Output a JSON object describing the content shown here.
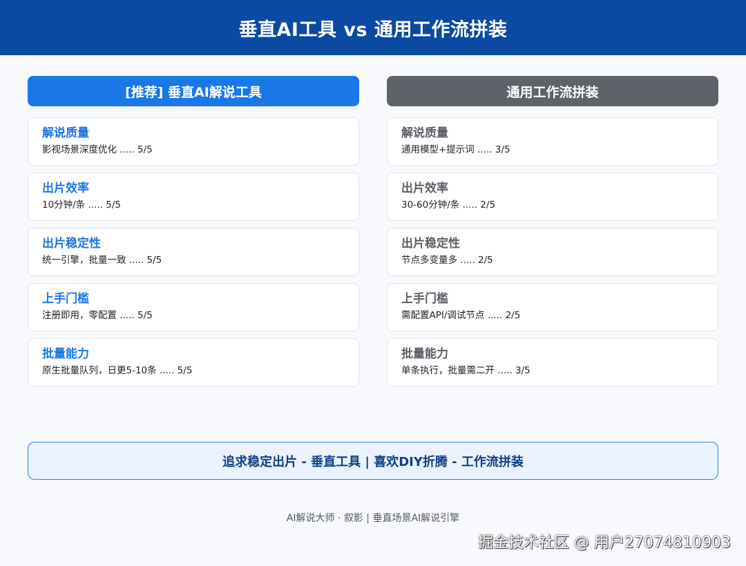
{
  "header": {
    "title": "垂直AI工具 vs 通用工作流拼装"
  },
  "left": {
    "title": "[推荐] 垂直AI解说工具",
    "items": [
      {
        "title": "解说质量",
        "detail": "影视场景深度优化 ..... 5/5"
      },
      {
        "title": "出片效率",
        "detail": "10分钟/条 ..... 5/5"
      },
      {
        "title": "出片稳定性",
        "detail": "统一引擎，批量一致 ..... 5/5"
      },
      {
        "title": "上手门槛",
        "detail": "注册即用，零配置 ..... 5/5"
      },
      {
        "title": "批量能力",
        "detail": "原生批量队列，日更5-10条 ..... 5/5"
      }
    ]
  },
  "right": {
    "title": "通用工作流拼装",
    "items": [
      {
        "title": "解说质量",
        "detail": "通用模型+提示词 ..... 3/5"
      },
      {
        "title": "出片效率",
        "detail": "30-60分钟/条 ..... 2/5"
      },
      {
        "title": "出片稳定性",
        "detail": "节点多变量多 ..... 2/5"
      },
      {
        "title": "上手门槛",
        "detail": "需配置API/调试节点 ..... 2/5"
      },
      {
        "title": "批量能力",
        "detail": "单条执行，批量需二开 ..... 3/5"
      }
    ]
  },
  "summary": {
    "text": "追求稳定出片 - 垂直工具 | 喜欢DIY折腾 - 工作流拼装"
  },
  "footer": {
    "text": "AI解说大师 · 叙影 | 垂直场景AI解说引擎"
  },
  "watermark": {
    "text": "掘金技术社区 @ 用户27074810903"
  },
  "colors": {
    "header_bg": "#0b4aa2",
    "recommended_accent": "#1977e6",
    "general_accent": "#5f6369",
    "summary_border": "#2f7fdc"
  }
}
